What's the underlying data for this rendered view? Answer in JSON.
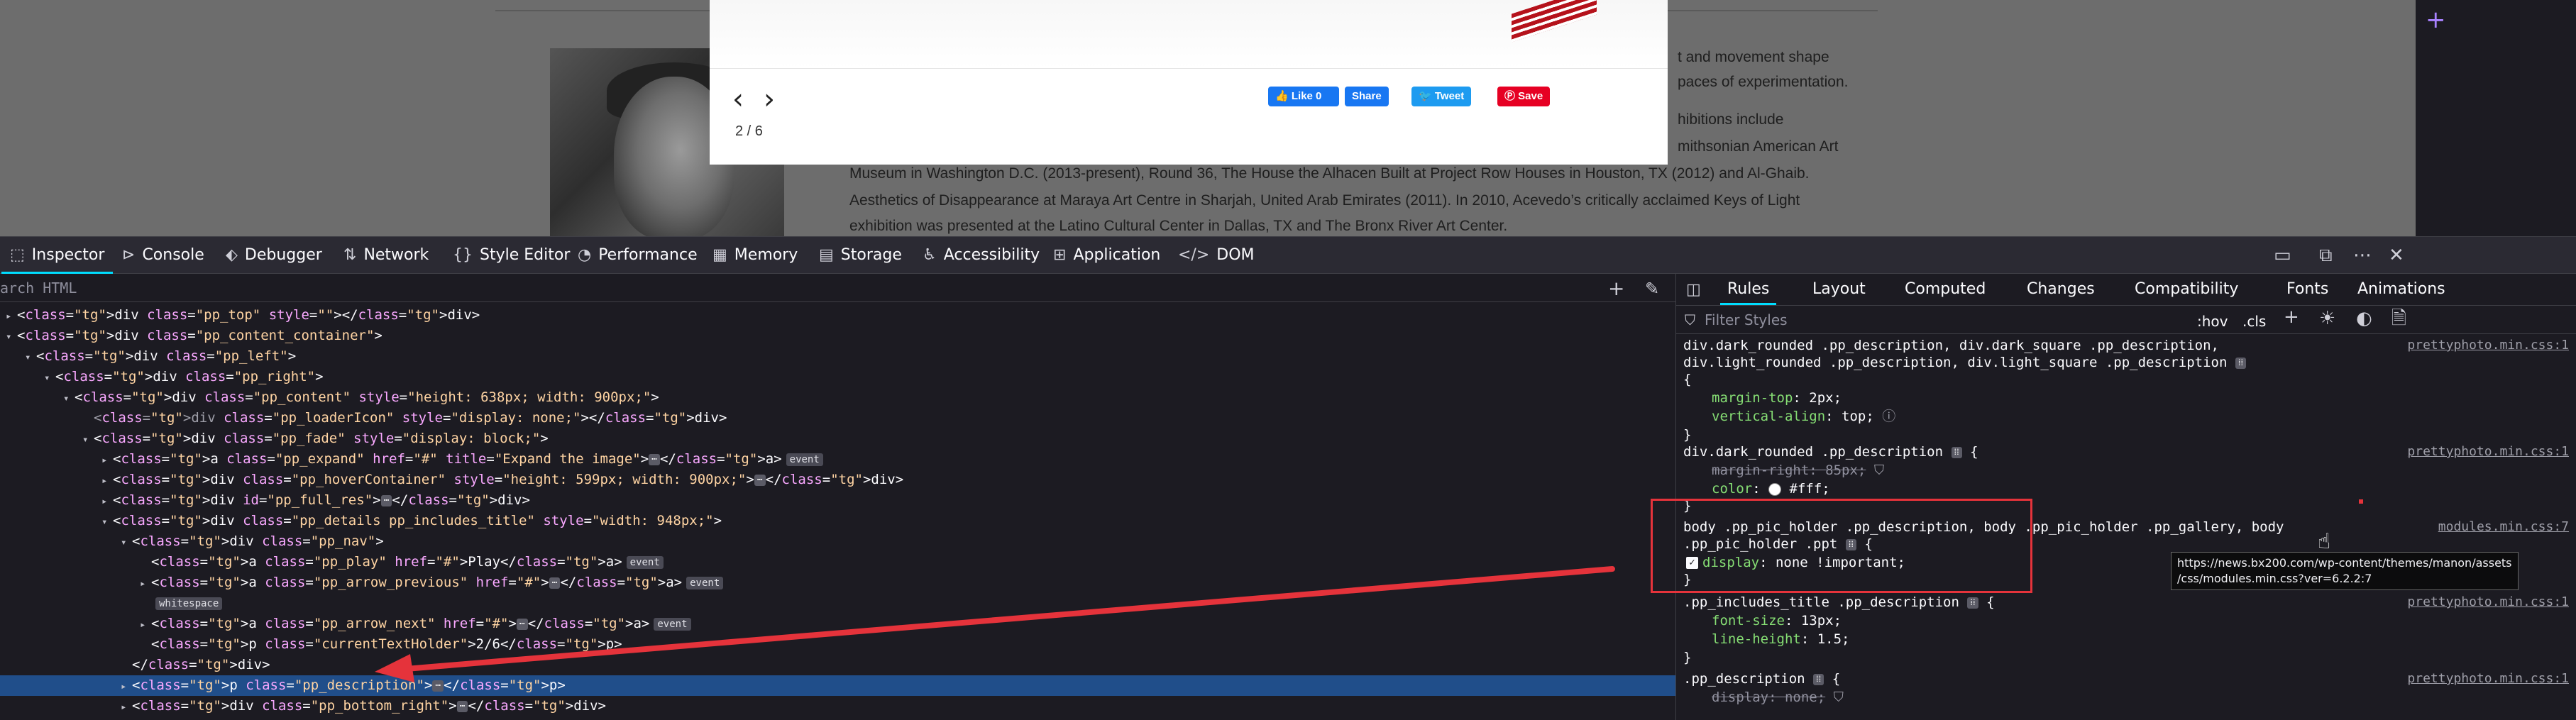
{
  "page": {
    "paragraph_lines": [
      "t and movement shape",
      "paces of experimentation.",
      "hibitions include",
      "mithsonian American Art",
      "Museum in Washington D.C. (2013-present), Round 36, The House the Alhacen Built at Project Row Houses in Houston, TX (2012) and Al-Ghaib.",
      "Aesthetics of Disappearance at Maraya Art Centre in Sharjah, United Arab Emirates (2011). In 2010, Acevedo’s critically acclaimed Keys of Light",
      "exhibition was presented at the Latino Cultural Center in Dallas, TX and The Bronx River Art Center."
    ],
    "lightbox": {
      "prev": "‹",
      "next": "›",
      "counter": "2 / 6",
      "like_label": "Like 0",
      "share_label": "Share",
      "tweet_label": "Tweet",
      "save_label": "Save"
    }
  },
  "toolbar": {
    "tabs": [
      "Inspector",
      "Console",
      "Debugger",
      "Network",
      "Style Editor",
      "Performance",
      "Memory",
      "Storage",
      "Accessibility",
      "Application",
      "DOM"
    ],
    "active_tab": "Inspector"
  },
  "html_pane": {
    "search_placeholder": "arch HTML",
    "lines": [
      {
        "t": "<div class=\"pp_top\" style=\"\"></div>"
      },
      {
        "t": "<div class=\"pp_content_container\">"
      },
      {
        "t": "<div class=\"pp_left\">"
      },
      {
        "t": "<div class=\"pp_right\">"
      },
      {
        "t": "<div class=\"pp_content\" style=\"height: 638px; width: 900px;\">"
      },
      {
        "t": "<div class=\"pp_loaderIcon\" style=\"display: none;\"></div>"
      },
      {
        "t": "<div class=\"pp_fade\" style=\"display: block;\">"
      },
      {
        "t": "<a class=\"pp_expand\" href=\"#\" title=\"Expand the image\"> </a>"
      },
      {
        "t": "<div class=\"pp_hoverContainer\" style=\"height: 599px; width: 900px;\"> </div>"
      },
      {
        "t": "<div id=\"pp_full_res\"> </div>"
      },
      {
        "t": "<div class=\"pp_details pp_includes_title\" style=\"width: 948px;\">"
      },
      {
        "t": "<div class=\"pp_nav\">"
      },
      {
        "t": "<a class=\"pp_play\" href=\"#\">Play</a>"
      },
      {
        "t": "<a class=\"pp_arrow_previous\" href=\"#\"> </a>"
      },
      {
        "t": "whitespace"
      },
      {
        "t": "<a class=\"pp_arrow_next\" href=\"#\"> </a>"
      },
      {
        "t": "<p class=\"currentTextHolder\">2/6</p>"
      },
      {
        "t": "</div>"
      },
      {
        "t": "<p class=\"pp_description\"> </p>"
      },
      {
        "t": "<div class=\"pp_bottom_right\"> </div>"
      },
      {
        "t": "</div>"
      }
    ],
    "badge_event": "event",
    "badge_whitespace": "whitespace",
    "text_play": "Play",
    "text_counter": "2/6"
  },
  "rules_pane": {
    "tabs": [
      "Rules",
      "Layout",
      "Computed",
      "Changes",
      "Compatibility",
      "Fonts",
      "Animations"
    ],
    "active_tab": "Rules",
    "filter_placeholder": "Filter Styles",
    "hov_label": ":hov",
    "cls_label": ".cls",
    "rules": [
      {
        "sel1": "div.dark_rounded .pp_description, div.dark_square .pp_description,",
        "sel2": "div.light_rounded .pp_description, div.light_square .pp_description",
        "source": "prettyphoto.min.css:1",
        "p1n": "margin-top",
        "p1v": "2px;",
        "p2n": "vertical-align",
        "p2v": "top;"
      },
      {
        "sel1": "div.dark_rounded .pp_description",
        "source": "prettyphoto.min.css:1",
        "p1n": "margin-right",
        "p1v": "85px;",
        "p2n": "color",
        "p2v": "#fff;"
      },
      {
        "sel1": "body .pp_pic_holder .pp_description, body .pp_pic_holder .pp_gallery, body",
        "sel2": ".pp_pic_holder .ppt",
        "source": "modules.min.css:7",
        "p1n": "display",
        "p1v": "none !important;"
      },
      {
        "sel1": ".pp_includes_title .pp_description",
        "source": "prettyphoto.min.css:1",
        "p1n": "font-size",
        "p1v": "13px;",
        "p2n": "line-height",
        "p2v": "1.5;"
      },
      {
        "sel1": ".pp_description",
        "source": "prettyphoto.min.css:1",
        "p1n": "display",
        "p1v": "none;"
      }
    ],
    "tooltip": "https://news.bx200.com/wp-content/themes/manon/assets\n/css/modules.min.css?ver=6.2.2:7"
  },
  "colors": {
    "accent": "#00ddff",
    "annotation_red": "#e5333b",
    "selection": "#204e8a"
  }
}
